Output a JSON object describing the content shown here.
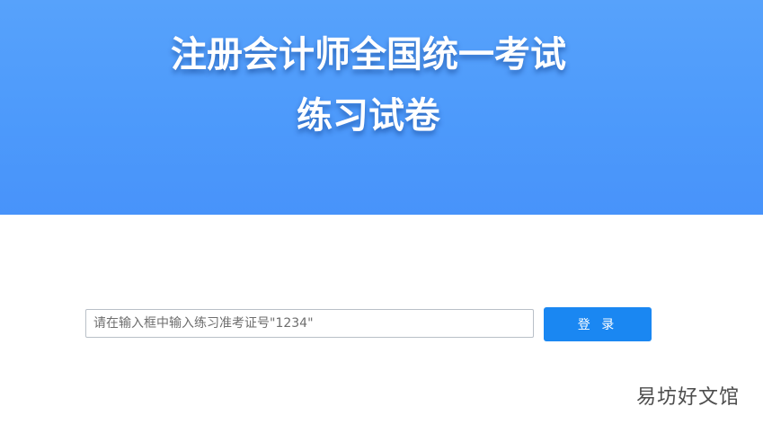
{
  "banner": {
    "title_line_1": "注册会计师全国统一考试",
    "title_line_2": "练习试卷",
    "background_color": "#4d9afb",
    "title_color": "#ffffff"
  },
  "login": {
    "ticket_input": {
      "placeholder": "请在输入框中输入练习准考证号\"1234\"",
      "value": ""
    },
    "button_label": "登 录",
    "button_color": "#1a87f2"
  },
  "watermark": {
    "text": "易坊好文馆"
  }
}
